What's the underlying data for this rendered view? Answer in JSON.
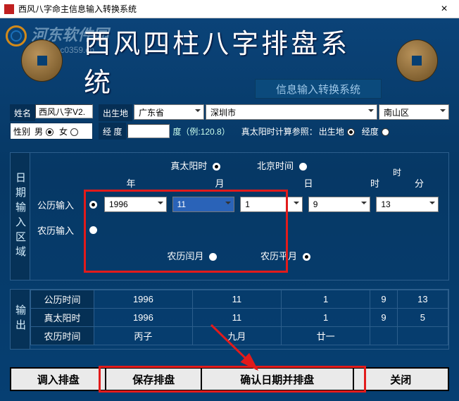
{
  "window_title": "西风八字命主信息输入转换系统",
  "watermark": "河东软件园",
  "watermark_url": "www.pc0359.cn",
  "app_title": "西风四柱八字排盘系统",
  "sub_button": "信息输入转换系统",
  "labels": {
    "name": "姓名",
    "gender": "性别",
    "male": "男",
    "female": "女",
    "birthplace": "出生地",
    "longitude": "经  度",
    "deg_hint": "度（例:120.8）",
    "solar_ref": "真太阳时计算参照：",
    "ref_place": "出生地",
    "ref_lon": "经度"
  },
  "name_value": "西风八字V2.",
  "location": {
    "province": "广东省",
    "city": "深圳市",
    "district": "南山区"
  },
  "side1": "日期输入区域",
  "time_modes": {
    "solar": "真太阳时",
    "beijing": "北京时间"
  },
  "headers": {
    "year": "年",
    "month": "月",
    "day": "日",
    "hour": "时",
    "minute": "分",
    "time": "时"
  },
  "rows": {
    "gongli": "公历输入",
    "nongli": "农历输入",
    "leap": "农历闰月",
    "flat": "农历平月"
  },
  "values": {
    "year": "1996",
    "month": "11",
    "day": "1",
    "hour": "9",
    "minute": "13"
  },
  "side2": "输出",
  "out": {
    "r1": {
      "label": "公历时间",
      "year": "1996",
      "month": "11",
      "day": "1",
      "hour": "9",
      "minute": "13"
    },
    "r2": {
      "label": "真太阳时",
      "year": "1996",
      "month": "11",
      "day": "1",
      "hour": "9",
      "minute": "5"
    },
    "r3": {
      "label": "农历时间",
      "year": "丙子",
      "month": "九月",
      "day": "廿一",
      "hour": "",
      "minute": ""
    }
  },
  "buttons": {
    "load": "调入排盘",
    "save": "保存排盘",
    "confirm": "确认日期并排盘",
    "close": "关闭"
  }
}
